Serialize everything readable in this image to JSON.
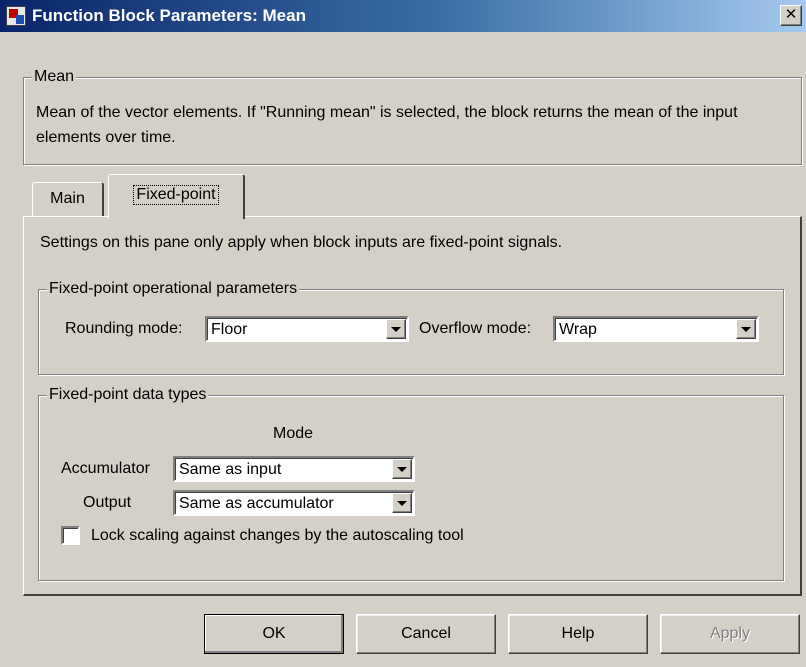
{
  "window": {
    "title": "Function Block Parameters: Mean",
    "close_glyph": "✕"
  },
  "description_group": {
    "title": "Mean",
    "text": "Mean of the vector elements. If \"Running mean\" is selected, the block returns the mean of the input elements over time."
  },
  "tabs": [
    {
      "label": "Main",
      "selected": false
    },
    {
      "label": "Fixed-point",
      "selected": true
    }
  ],
  "fixed_point_pane": {
    "note": "Settings on this pane only apply when block inputs are fixed-point signals.",
    "operational_params": {
      "title": "Fixed-point operational parameters",
      "rounding_label": "Rounding mode:",
      "rounding_value": "Floor",
      "overflow_label": "Overflow mode:",
      "overflow_value": "Wrap"
    },
    "data_types": {
      "title": "Fixed-point data types",
      "mode_header": "Mode",
      "accumulator_label": "Accumulator",
      "accumulator_value": "Same as input",
      "output_label": "Output",
      "output_value": "Same as accumulator",
      "lock_scaling_label": "Lock scaling against changes by the autoscaling tool",
      "lock_scaling_checked": false
    }
  },
  "buttons": {
    "ok": "OK",
    "cancel": "Cancel",
    "help": "Help",
    "apply": "Apply",
    "apply_enabled": false
  },
  "icons": {
    "app": "simulink-block-icon",
    "close": "close-icon",
    "dropdown": "chevron-down-icon"
  }
}
